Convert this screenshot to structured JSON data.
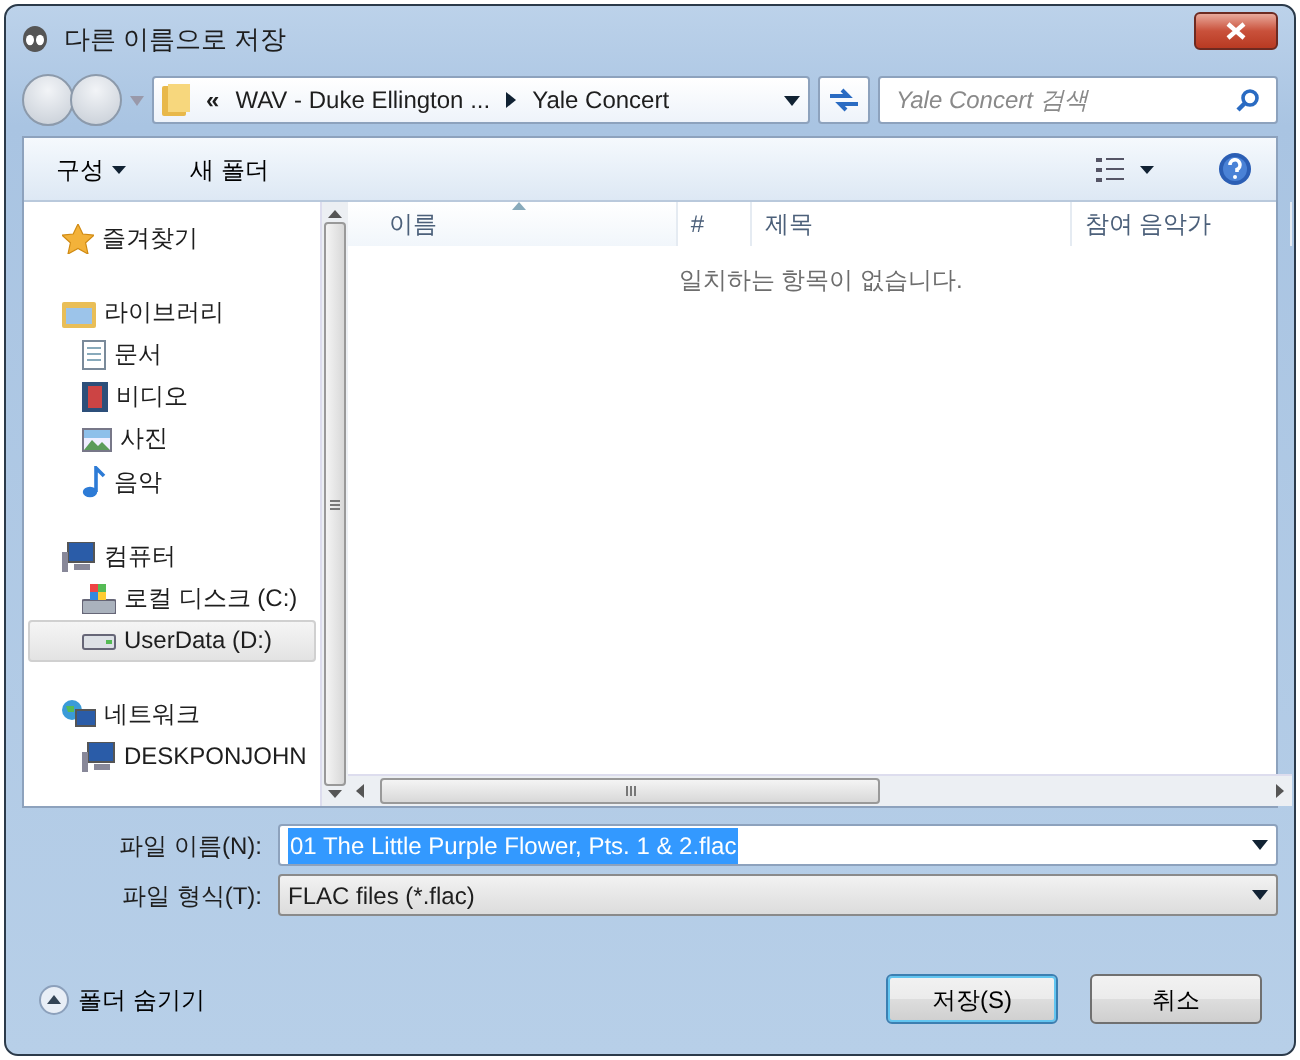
{
  "window": {
    "title": "다른 이름으로 저장"
  },
  "address": {
    "overflow": "«",
    "segments": [
      "WAV - Duke Ellington ...",
      "Yale Concert"
    ]
  },
  "search": {
    "placeholder": "Yale Concert 검색"
  },
  "toolbar": {
    "organize": "구성",
    "new_folder": "새 폴더"
  },
  "sidebar": {
    "groups": [
      {
        "label": "즐겨찾기",
        "kind": "favorites",
        "selected": false
      },
      {
        "label": "라이브러리",
        "kind": "library",
        "selected": false,
        "children": [
          {
            "label": "문서",
            "kind": "documents",
            "selected": false
          },
          {
            "label": "비디오",
            "kind": "videos",
            "selected": false
          },
          {
            "label": "사진",
            "kind": "pictures",
            "selected": false
          },
          {
            "label": "음악",
            "kind": "music",
            "selected": false
          }
        ]
      },
      {
        "label": "컴퓨터",
        "kind": "computer",
        "selected": false,
        "children": [
          {
            "label": "로컬 디스크 (C:)",
            "kind": "disk",
            "selected": false
          },
          {
            "label": "UserData (D:)",
            "kind": "drive",
            "selected": true
          }
        ]
      },
      {
        "label": "네트워크",
        "kind": "network",
        "selected": false,
        "children": [
          {
            "label": "DESKPONJOHN",
            "kind": "computer",
            "selected": false
          }
        ]
      }
    ]
  },
  "file_list": {
    "columns": [
      {
        "label": "이름",
        "sorted": true
      },
      {
        "label": "#",
        "sorted": false
      },
      {
        "label": "제목",
        "sorted": false
      },
      {
        "label": "참여 음악가",
        "sorted": false
      }
    ],
    "empty_message": "일치하는 항목이 없습니다."
  },
  "form": {
    "file_name_label": "파일 이름(N):",
    "file_name": "01 The Little Purple Flower, Pts. 1 & 2.flac",
    "file_type_label": "파일 형식(T):",
    "file_type": "FLAC files (*.flac)"
  },
  "hide_folders": "폴더 숨기기",
  "buttons": [
    {
      "label": "저장(S)",
      "default": true
    },
    {
      "label": "취소",
      "default": false
    }
  ]
}
